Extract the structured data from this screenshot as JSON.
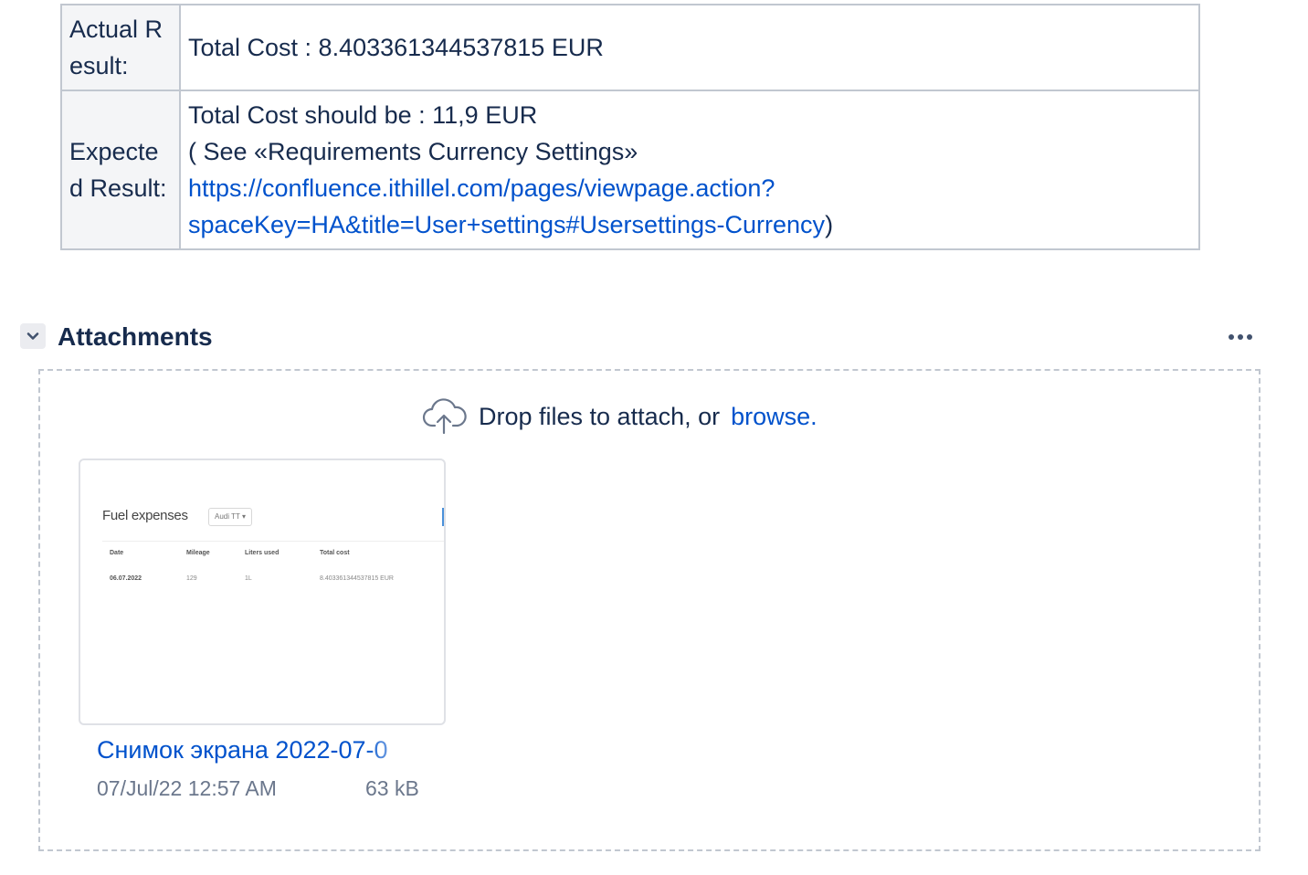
{
  "details": {
    "actual_label": "Actual Result:",
    "actual_value": "Total Cost : 8.403361344537815 EUR",
    "expected_label": "Expected Result:",
    "expected_line1": "Total Cost should be : 11,9 EUR",
    "expected_line2": "( See «Requirements Currency Settings»",
    "expected_link_part1": "https://confluence.ithillel.com/pages/viewpage.action?",
    "expected_link_part2": "spaceKey=HA&title=User+settings#Usersettings-Currency",
    "expected_close": ")"
  },
  "attachments": {
    "title": "Attachments",
    "drop_text": "Drop files to attach, or",
    "browse_label": "browse.",
    "items": [
      {
        "name": "Снимок экрана 2022-07-0",
        "date": "07/Jul/22 12:57 AM",
        "size": "63 kB",
        "thumbnail": {
          "title": "Fuel expenses",
          "select": "Audi TT ▾",
          "headers": [
            "Date",
            "Mileage",
            "Liters used",
            "Total cost"
          ],
          "row": [
            "06.07.2022",
            "129",
            "1L",
            "8.403361344537815 EUR"
          ]
        }
      }
    ]
  },
  "icons": {
    "collapse": "chevron-down-icon",
    "more": "more-icon",
    "upload": "cloud-upload-icon"
  },
  "colors": {
    "link": "#0052cc",
    "text": "#172b4d",
    "muted": "#6b778c",
    "border": "#c1c7d0"
  }
}
